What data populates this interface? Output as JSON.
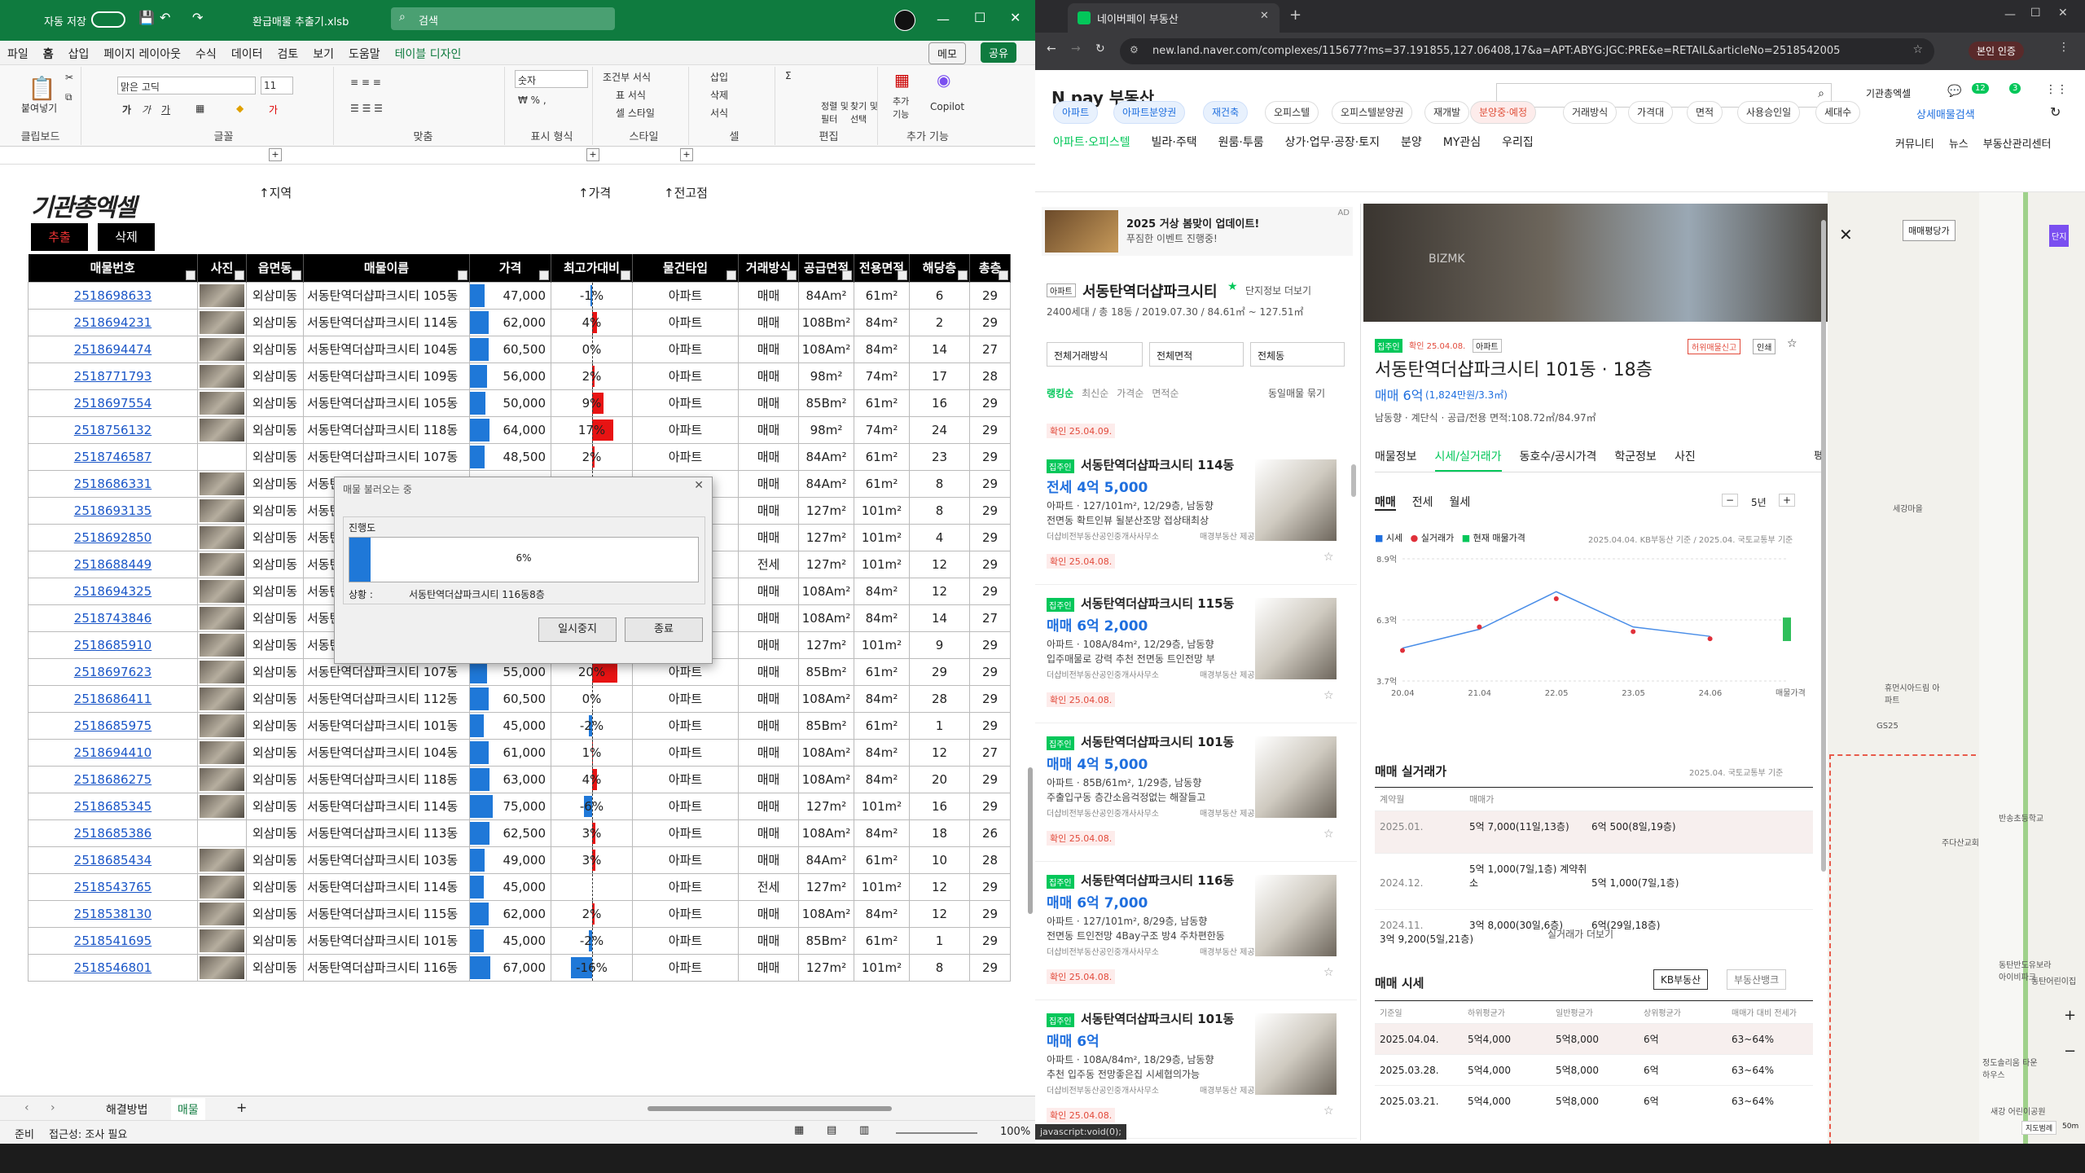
{
  "excel": {
    "autosave": "자동 저장",
    "filename": "환급매물 추출기.xlsb",
    "search_placeholder": "검색",
    "menu": [
      "파일",
      "홈",
      "삽입",
      "페이지 레이아웃",
      "수식",
      "데이터",
      "검토",
      "보기",
      "도움말",
      "테이블 디자인"
    ],
    "memo": "메모",
    "share": "공유",
    "ribbon": {
      "paste": "붙여넣기",
      "clipboard": "클립보드",
      "font_name": "맑은 고딕",
      "font_size": "11",
      "font": "글꼴",
      "align": "맞춤",
      "number_format": "숫자",
      "number": "표시 형식",
      "cond_format": "조건부 서식",
      "table_format": "표 서식",
      "cell_style": "셀 스타일",
      "style": "스타일",
      "insert": "삽입",
      "delete": "삭제",
      "format": "서식",
      "cells": "셀",
      "sort": "정렬 및\n필터",
      "find": "찾기 및\n선택",
      "edit": "편집",
      "addin": "추가\n기능",
      "addin_group": "추가 기능",
      "copilot": "Copilot"
    },
    "logo": "기관총엑셀",
    "btn_extract": "추출",
    "btn_delete": "삭제",
    "labels": {
      "region": "↑지역",
      "price": "↑가격",
      "jeon": "↑전고점"
    },
    "headers": [
      "매물번호",
      "사진",
      "읍면동",
      "매물이름",
      "가격",
      "최고가대비",
      "물건타입",
      "거래방식",
      "공급면적",
      "전용면적",
      "해당층",
      "총층"
    ],
    "rows": [
      [
        "2518698633",
        true,
        "외삼미동",
        "서동탄역더샵파크시티 105동",
        "47,000",
        "-1%",
        "아파트",
        "매매",
        "84Am²",
        "61m²",
        "6",
        "29"
      ],
      [
        "2518694231",
        true,
        "외삼미동",
        "서동탄역더샵파크시티 114동",
        "62,000",
        "4%",
        "아파트",
        "매매",
        "108Bm²",
        "84m²",
        "2",
        "29"
      ],
      [
        "2518694474",
        true,
        "외삼미동",
        "서동탄역더샵파크시티 104동",
        "60,500",
        "0%",
        "아파트",
        "매매",
        "108Am²",
        "84m²",
        "14",
        "27"
      ],
      [
        "2518771793",
        true,
        "외삼미동",
        "서동탄역더샵파크시티 109동",
        "56,000",
        "2%",
        "아파트",
        "매매",
        "98m²",
        "74m²",
        "17",
        "28"
      ],
      [
        "2518697554",
        true,
        "외삼미동",
        "서동탄역더샵파크시티 105동",
        "50,000",
        "9%",
        "아파트",
        "매매",
        "85Bm²",
        "61m²",
        "16",
        "29"
      ],
      [
        "2518756132",
        true,
        "외삼미동",
        "서동탄역더샵파크시티 118동",
        "64,000",
        "17%",
        "아파트",
        "매매",
        "98m²",
        "74m²",
        "24",
        "29"
      ],
      [
        "2518746587",
        false,
        "외삼미동",
        "서동탄역더샵파크시티 107동",
        "48,500",
        "2%",
        "아파트",
        "매매",
        "84Am²",
        "61m²",
        "23",
        "29"
      ],
      [
        "2518686331",
        true,
        "외삼미동",
        "서동탄역더샵파크시티 101동",
        "",
        "",
        "아파트",
        "매매",
        "84Am²",
        "61m²",
        "8",
        "29"
      ],
      [
        "2518693135",
        true,
        "외삼미동",
        "서동탄역더샵파크시티 108동",
        "",
        "",
        "아파트",
        "매매",
        "127m²",
        "101m²",
        "8",
        "29"
      ],
      [
        "2518692850",
        true,
        "외삼미동",
        "서동탄역더샵파크시티 113동",
        "",
        "",
        "아파트",
        "매매",
        "127m²",
        "101m²",
        "4",
        "29"
      ],
      [
        "2518688449",
        true,
        "외삼미동",
        "서동탄역더샵파크시티 112동",
        "",
        "",
        "아파트",
        "전세",
        "127m²",
        "101m²",
        "12",
        "29"
      ],
      [
        "2518694325",
        true,
        "외삼미동",
        "서동탄역더샵파크시티 103동",
        "",
        "",
        "아파트",
        "매매",
        "108Am²",
        "84m²",
        "12",
        "29"
      ],
      [
        "2518743846",
        true,
        "외삼미동",
        "서동탄역더샵파크시티 104동",
        "",
        "",
        "아파트",
        "매매",
        "108Am²",
        "84m²",
        "14",
        "27"
      ],
      [
        "2518685910",
        true,
        "외삼미동",
        "서동탄역더샵파크시티 116동",
        "",
        "",
        "아파트",
        "매매",
        "127m²",
        "101m²",
        "9",
        "29"
      ],
      [
        "2518697623",
        true,
        "외삼미동",
        "서동탄역더샵파크시티 107동",
        "55,000",
        "20%",
        "아파트",
        "매매",
        "85Bm²",
        "61m²",
        "29",
        "29"
      ],
      [
        "2518686411",
        true,
        "외삼미동",
        "서동탄역더샵파크시티 112동",
        "60,500",
        "0%",
        "아파트",
        "매매",
        "108Am²",
        "84m²",
        "28",
        "29"
      ],
      [
        "2518685975",
        true,
        "외삼미동",
        "서동탄역더샵파크시티 101동",
        "45,000",
        "-2%",
        "아파트",
        "매매",
        "85Bm²",
        "61m²",
        "1",
        "29"
      ],
      [
        "2518694410",
        true,
        "외삼미동",
        "서동탄역더샵파크시티 104동",
        "61,000",
        "1%",
        "아파트",
        "매매",
        "108Am²",
        "84m²",
        "12",
        "27"
      ],
      [
        "2518686275",
        true,
        "외삼미동",
        "서동탄역더샵파크시티 118동",
        "63,000",
        "4%",
        "아파트",
        "매매",
        "108Am²",
        "84m²",
        "20",
        "29"
      ],
      [
        "2518685345",
        true,
        "외삼미동",
        "서동탄역더샵파크시티 114동",
        "75,000",
        "-6%",
        "아파트",
        "매매",
        "127m²",
        "101m²",
        "16",
        "29"
      ],
      [
        "2518685386",
        false,
        "외삼미동",
        "서동탄역더샵파크시티 113동",
        "62,500",
        "3%",
        "아파트",
        "매매",
        "108Am²",
        "84m²",
        "18",
        "26"
      ],
      [
        "2518685434",
        true,
        "외삼미동",
        "서동탄역더샵파크시티 103동",
        "49,000",
        "3%",
        "아파트",
        "매매",
        "84Am²",
        "61m²",
        "10",
        "28"
      ],
      [
        "2518543765",
        true,
        "외삼미동",
        "서동탄역더샵파크시티 114동",
        "45,000",
        "",
        "아파트",
        "전세",
        "127m²",
        "101m²",
        "12",
        "29"
      ],
      [
        "2518538130",
        true,
        "외삼미동",
        "서동탄역더샵파크시티 115동",
        "62,000",
        "2%",
        "아파트",
        "매매",
        "108Am²",
        "84m²",
        "12",
        "29"
      ],
      [
        "2518541695",
        true,
        "외삼미동",
        "서동탄역더샵파크시티 101동",
        "45,000",
        "-2%",
        "아파트",
        "매매",
        "85Bm²",
        "61m²",
        "1",
        "29"
      ],
      [
        "2518546801",
        true,
        "외삼미동",
        "서동탄역더샵파크시티 116동",
        "67,000",
        "-16%",
        "아파트",
        "매매",
        "127m²",
        "101m²",
        "8",
        "29"
      ]
    ],
    "price_fill": [
      0.47,
      0.62,
      0.605,
      0.56,
      0.5,
      0.64,
      0.485,
      0,
      0,
      0,
      0,
      0,
      0,
      0,
      0.55,
      0.605,
      0.45,
      0.61,
      0.63,
      0.75,
      0.625,
      0.49,
      0.45,
      0.62,
      0.45,
      0.67
    ],
    "compare_pct": [
      -1,
      4,
      0,
      2,
      9,
      17,
      2,
      0,
      0,
      0,
      0,
      0,
      0,
      0,
      20,
      0,
      -2,
      1,
      4,
      -6,
      3,
      3,
      0,
      2,
      -2,
      -16
    ],
    "dialog": {
      "title": "매물 불러오는 중",
      "progress_label": "진행도",
      "progress_text": "6%",
      "progress": 0.06,
      "status_label": "상황 :",
      "status": "서동탄역더샵파크시티 116동8층",
      "pause": "일시중지",
      "stop": "종료"
    },
    "sheets": [
      "해결방법",
      "매물"
    ],
    "status": {
      "ready": "준비",
      "access": "접근성: 조사 필요",
      "zoom": "100%"
    }
  },
  "browser": {
    "tab_title": "네이버페이 부동산",
    "url": "new.land.naver.com/complexes/115677?ms=37.191855,127.06408,17&a=APT:ABYG:JGC:PRE&e=RETAIL&articleNo=2518542005",
    "verify": "본인 인증",
    "logo": "N pay 부동산",
    "user": "기관총엑셀",
    "badges": [
      "12",
      "3"
    ],
    "nav": [
      "아파트·오피스텔",
      "빌라·주택",
      "원룸·투룸",
      "상가·업무·공장·토지",
      "분양",
      "MY관심",
      "우리집"
    ],
    "nav_right": [
      "커뮤니티",
      "뉴스",
      "부동산관리센터"
    ],
    "chips": [
      "아파트",
      "아파트분양권",
      "재건축",
      "오피스텔",
      "오피스텔분양권",
      "재개발",
      "분양중·예정"
    ],
    "filters": [
      "거래방식",
      "가격대",
      "면적",
      "사용승인일",
      "세대수"
    ],
    "detail_search": "상세매물검색",
    "ad": {
      "title": "2025 거상 봄맞이 업데이트!",
      "sub": "푸짐한 이벤트 진행중!",
      "tag": "AD"
    },
    "complex": {
      "name": "서동탄역더샵파크시티",
      "info_link": "단지정보 더보기",
      "meta": "2400세대 / 총 18동 / 2019.07.30 / 84.61㎡ ~ 127.51㎡"
    },
    "selects": [
      "전체거래방식",
      "전체면적",
      "전체동"
    ],
    "sorts": [
      "랭킹순",
      "최신순",
      "가격순",
      "면적순"
    ],
    "same_hide": "동일매물 묶기",
    "confirmed_top": "확인 25.04.09.",
    "cards": [
      {
        "title": "서동탄역더샵파크시티 114동",
        "price": "전세 4억 5,000",
        "line1": "아파트 · 127/101m², 12/29층, 남동향",
        "line2": "전면동 확트인뷰 될분산조망 접상태최상",
        "agent": "더샵비전부동산공인중개사사무소",
        "src": "매경부동산 제공",
        "date": "확인 25.04.08."
      },
      {
        "title": "서동탄역더샵파크시티 115동",
        "price": "매매 6억 2,000",
        "line1": "아파트 · 108A/84m², 12/29층, 남동향",
        "line2": "입주매물로 강력 추천 전면동 트인전망 부",
        "agent": "더샵비전부동산공인중개사사무소",
        "src": "매경부동산 제공",
        "date": "확인 25.04.08."
      },
      {
        "title": "서동탄역더샵파크시티 101동",
        "price": "매매 4억 5,000",
        "line1": "아파트 · 85B/61m², 1/29층, 남동향",
        "line2": "주출입구동 층간소음걱정없는 해잘들고",
        "agent": "더샵비전부동산공인중개사사무소",
        "src": "매경부동산 제공",
        "date": "확인 25.04.08."
      },
      {
        "title": "서동탄역더샵파크시티 116동",
        "price": "매매 6억 7,000",
        "line1": "아파트 · 127/101m², 8/29층, 남동향",
        "line2": "전면동 트인전망 4Bay구조 방4 주차편한동",
        "agent": "더샵비전부동산공인중개사사무소",
        "src": "매경부동산 제공",
        "date": "확인 25.04.08."
      },
      {
        "title": "서동탄역더샵파크시티 101동",
        "price": "매매 6억",
        "line1": "아파트 · 108A/84m², 18/29층, 남동향",
        "line2": "추천 입주동 전망좋은집 시세협의가능",
        "agent": "더샵비전부동산공인중개사사무소",
        "src": "매경부동산 제공",
        "date": "확인 25.04.08."
      }
    ],
    "card_tag": "집주인",
    "detail": {
      "tag": "집주인",
      "date_tag": "확인 25.04.08.",
      "type_tag": "아파트",
      "title": "서동탄역더샵파크시티 101동 · 18층",
      "price": "매매 6억",
      "unit_price": "(1,824만원/3.3㎡)",
      "info": "남동향 · 계단식 · 공급/전용 면적:108.72㎡/84.97㎡",
      "report": "허위매물신고",
      "print": "인쇄",
      "tabs": [
        "매물정보",
        "시세/실거래가",
        "동호수/공시가격",
        "학군정보",
        "사진"
      ],
      "area_toggle": "평",
      "subtabs": [
        "매매",
        "전세",
        "월세"
      ],
      "years": "5년",
      "legend": [
        "시세",
        "실거래가",
        "현재 매물가격"
      ],
      "source": "2025.04.04. KB부동산 기준 / 2025.04. 국토교통부 기준",
      "real_title": "매매 실거래가",
      "real_source": "2025.04. 국토교통부 기준",
      "real_header": [
        "계약월",
        "매매가"
      ],
      "real_rows": [
        [
          "2025.01.",
          "5억 7,000(11일,13층)",
          "6억 500(8일,19층)",
          ""
        ],
        [
          "2024.12.",
          "5억 1,000(7일,1층) 계약취소",
          "5억 1,000(7일,1층)",
          ""
        ],
        [
          "2024.11.",
          "3억 8,000(30일,6층)",
          "6억(29일,18층)",
          "3억 9,200(5일,21층)"
        ]
      ],
      "more": "실거래가 더보기",
      "market_title": "매매 시세",
      "kb": "KB부동산",
      "bank": "부동산뱅크",
      "market_header": [
        "기준일",
        "하위평균가",
        "일반평균가",
        "상위평균가",
        "매매가 대비 전세가"
      ],
      "market_rows": [
        [
          "2025.04.04.",
          "5억4,000",
          "5억8,000",
          "6억",
          "63~64%"
        ],
        [
          "2025.03.28.",
          "5억4,000",
          "5억8,000",
          "6억",
          "63~64%"
        ],
        [
          "2025.03.21.",
          "5억4,000",
          "5억8,000",
          "6억",
          "63~64%"
        ]
      ]
    },
    "chart_data": {
      "type": "line",
      "title": "",
      "x": [
        "20.04",
        "21.04",
        "22.05",
        "23.05",
        "24.06",
        "매물가격"
      ],
      "yticks": [
        "8.9억",
        "6.3억",
        "3.7억"
      ],
      "ylim": [
        3.7,
        8.9
      ],
      "series": [
        {
          "name": "시세",
          "values": [
            5.1,
            5.9,
            7.5,
            6.0,
            5.6,
            5.8
          ]
        },
        {
          "name": "실거래가",
          "values": [
            5.0,
            6.0,
            7.2,
            5.8,
            5.5,
            5.7
          ]
        },
        {
          "name": "현재 매물가격",
          "values": [
            null,
            null,
            null,
            null,
            null,
            6.0
          ]
        }
      ]
    },
    "map": {
      "poi": [
        "세강마을",
        "휴먼시아드림 아파트",
        "GS25",
        "반송초등학교",
        "주다산교회",
        "동탄반도유보라 아이비파크",
        "동탄어린이집",
        "정도솔리움 타운하우스",
        "새강 어린이공원"
      ],
      "dropdown": "매매평당가",
      "danji": "단지",
      "scale": "50m",
      "map_btn": "지도범례"
    },
    "status_url": "javascript:void(0);"
  }
}
